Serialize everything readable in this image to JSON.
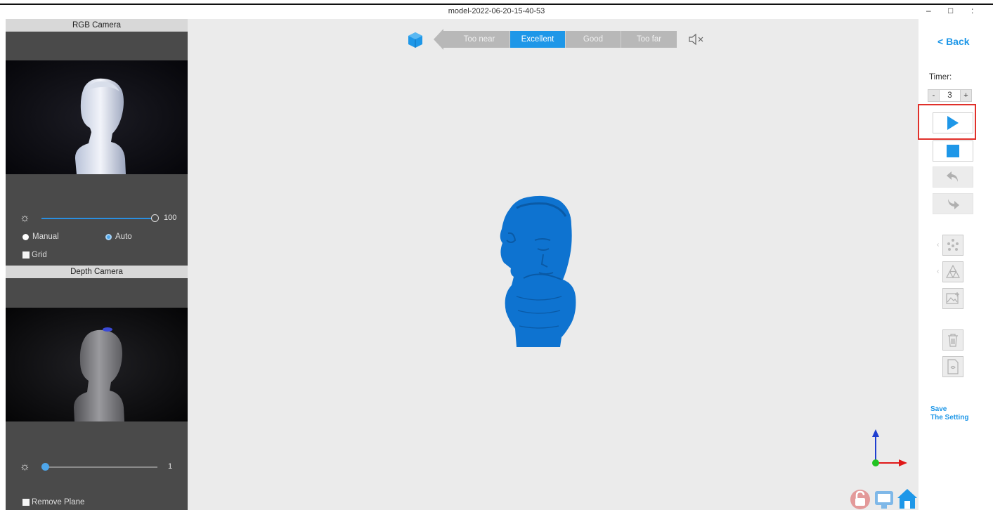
{
  "window": {
    "title": "model-2022-06-20-15-40-53",
    "minimize": "–",
    "maximize": "□",
    "close": ":"
  },
  "rgb_camera": {
    "header": "RGB Camera",
    "brightness_value": "100",
    "brightness_level": 1.0,
    "mode_manual": "Manual",
    "mode_auto": "Auto",
    "mode_selected": "Auto",
    "grid_label": "Grid"
  },
  "depth_camera": {
    "header": "Depth Camera",
    "brightness_value": "1",
    "brightness_level": 0.0,
    "remove_plane_label": "Remove Plane"
  },
  "distance_indicator": {
    "segments": [
      "Too near",
      "Excellent",
      "Good",
      "Too far"
    ],
    "active": "Excellent"
  },
  "right_panel": {
    "back_label": "< Back",
    "timer_label": "Timer:",
    "timer_minus": "-",
    "timer_value": "3",
    "timer_plus": "+",
    "save_setting_line1": "Save",
    "save_setting_line2": "The Setting"
  },
  "colors": {
    "accent": "#1e97e8",
    "model": "#0e73d0",
    "highlight": "#e0302a"
  }
}
